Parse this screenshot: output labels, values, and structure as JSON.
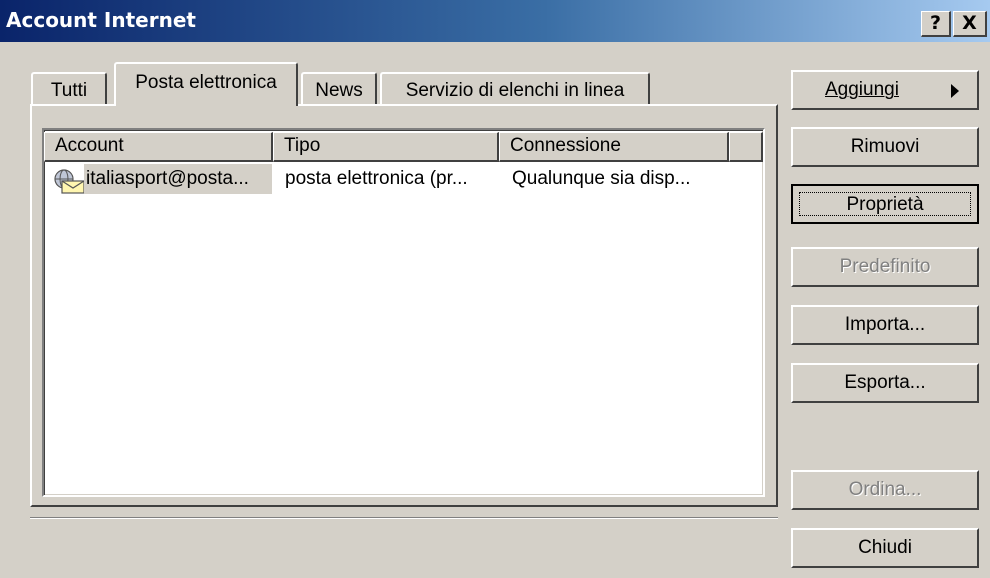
{
  "window": {
    "title": "Account Internet",
    "help_glyph": "?",
    "close_glyph": "X"
  },
  "tabs": [
    "Tutti",
    "Posta elettronica",
    "News",
    "Servizio di elenchi in linea"
  ],
  "list": {
    "columns": [
      "Account",
      "Tipo",
      "Connessione"
    ],
    "rows": [
      {
        "icon": "mail-account-icon",
        "account": "italiasport@posta...",
        "type": "posta elettronica (pr...",
        "connection": "Qualunque sia disp..."
      }
    ]
  },
  "buttons": {
    "add": "Aggiungi",
    "remove": "Rimuovi",
    "properties": "Proprietà",
    "set_default": "Predefinito",
    "import": "Importa...",
    "export": "Esporta...",
    "order": "Ordina...",
    "close": "Chiudi"
  },
  "colors": {
    "title_bar_start": "#0a246a",
    "title_bar_end": "#a6caf0",
    "dialog_face": "#d4d0c8",
    "selection": "#d4d0c8"
  }
}
